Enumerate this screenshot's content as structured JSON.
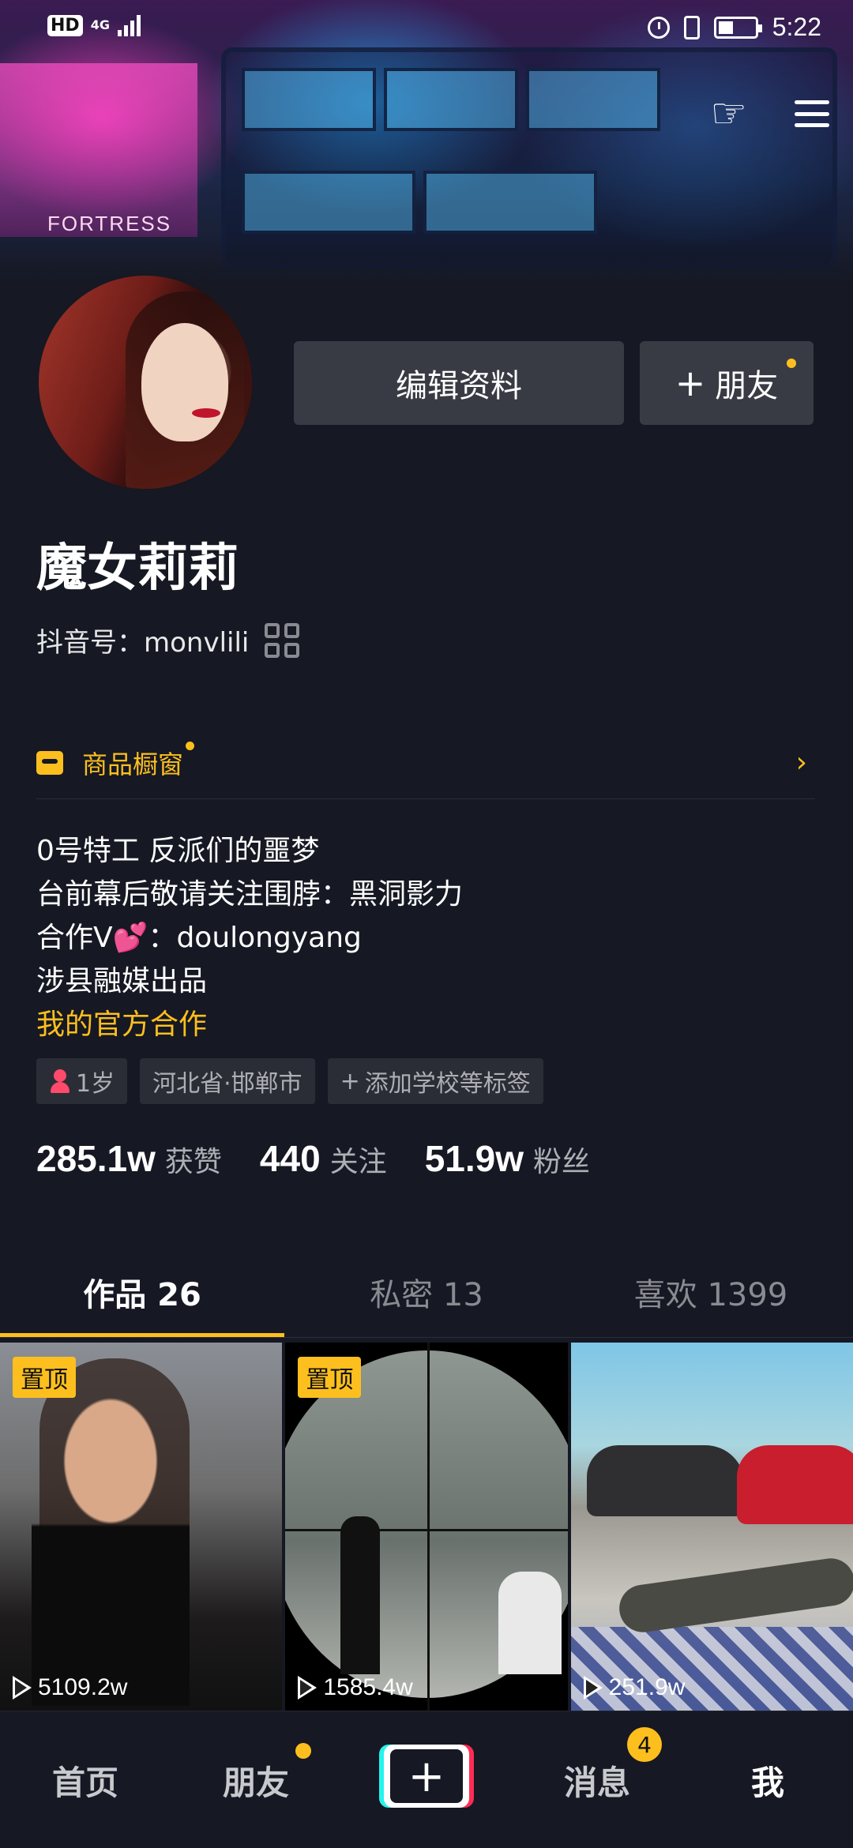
{
  "status_bar": {
    "network_badge": "HD",
    "network_type": "4G",
    "time": "5:22"
  },
  "cover": {
    "sign_text": "FORTRESS"
  },
  "profile": {
    "edit_button": "编辑资料",
    "add_friend_button": "朋友",
    "nickname": "魔女莉莉",
    "douyin_id_label": "抖音号：",
    "douyin_id": "monvlili",
    "shop_label": "商品橱窗"
  },
  "bio": {
    "lines": [
      "0号特工 反派们的噩梦",
      "台前幕后敬请关注围脖：黑洞影力",
      "合作V💕：doulongyang",
      "涉县融媒出品"
    ],
    "official_link": "我的官方合作"
  },
  "tags": {
    "age": "1岁",
    "location": "河北省·邯郸市",
    "add_school": "添加学校等标签"
  },
  "stats": {
    "likes_value": "285.1w",
    "likes_label": "获赞",
    "following_value": "440",
    "following_label": "关注",
    "followers_value": "51.9w",
    "followers_label": "粉丝"
  },
  "tabs": {
    "works": "作品 26",
    "private": "私密 13",
    "likes": "喜欢 1399"
  },
  "videos": [
    {
      "pin_label": "置顶",
      "views": "5109.2w"
    },
    {
      "pin_label": "置顶",
      "views": "1585.4w"
    },
    {
      "views": "251.9w"
    }
  ],
  "bottom_nav": {
    "home": "首页",
    "friends": "朋友",
    "create": "+",
    "messages": "消息",
    "messages_badge": "4",
    "me": "我"
  },
  "colors": {
    "background": "#161823",
    "accent": "#fcbf1e",
    "button": "#393b44",
    "muted_text": "#aeafb5"
  }
}
